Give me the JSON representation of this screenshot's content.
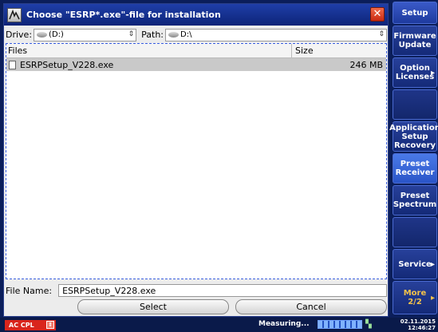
{
  "dialog": {
    "title": "Choose \"ESRP*.exe\"-file for installation",
    "close_glyph": "✕",
    "drive_label": "Drive:",
    "drive_value": "(D:)",
    "path_label": "Path:",
    "path_value": "D:\\",
    "select_arrow": "⇕",
    "columns": {
      "files": "Files",
      "size": "Size"
    },
    "files": [
      {
        "name": "ESRPSetup_V228.exe",
        "size": "246 MB"
      }
    ],
    "file_name_label": "File Name:",
    "file_name_value": "ESRPSetup_V228.exe",
    "select_button": "Select",
    "cancel_button": "Cancel"
  },
  "softkeys": {
    "setup": "Setup",
    "firmware_update": [
      "Firmware",
      "Update"
    ],
    "option_licenses": [
      "Option",
      "Licenses"
    ],
    "application_setup_recovery": [
      "Application",
      "Setup",
      "Recovery"
    ],
    "preset_receiver": [
      "Preset",
      "Receiver"
    ],
    "preset_spectrum": [
      "Preset",
      "Spectrum"
    ],
    "service": "Service",
    "more": [
      "More",
      "2/2"
    ],
    "arrow_glyph": "▸"
  },
  "statusbar": {
    "coupling": "AC CPL",
    "status": "Measuring...",
    "progress": 1.0,
    "date": "02.11.2015",
    "time": "12:46:27"
  },
  "colors": {
    "titlebar": "#1f3fa8",
    "softkey": "#142a78",
    "ac_coupling": "#d9251c"
  }
}
